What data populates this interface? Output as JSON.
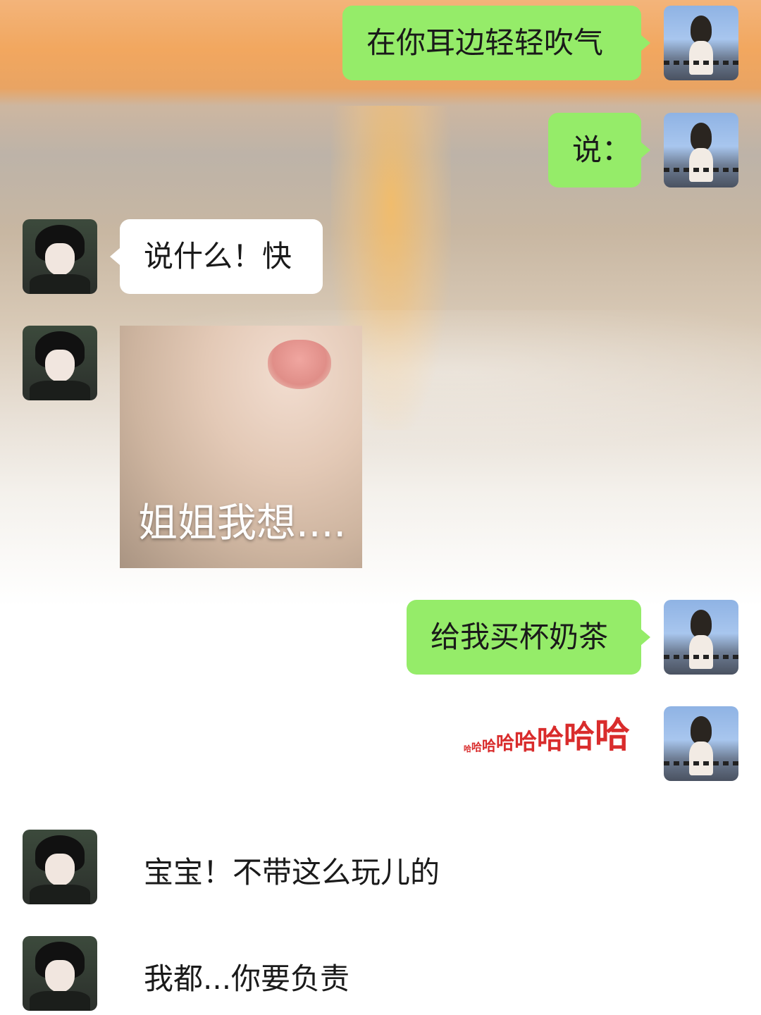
{
  "messages": [
    {
      "side": "right",
      "type": "text",
      "text": "在你耳边轻轻吹气"
    },
    {
      "side": "right",
      "type": "text",
      "text": "说："
    },
    {
      "side": "left",
      "type": "text",
      "text": "说什么！快"
    },
    {
      "side": "left",
      "type": "sticker",
      "caption": "姐姐我想...."
    },
    {
      "side": "right",
      "type": "text",
      "text": "给我买杯奶茶"
    },
    {
      "side": "right",
      "type": "emoji-text",
      "parts": [
        "哈",
        "哈",
        "哈",
        "哈",
        "哈",
        "哈",
        "哈",
        "哈"
      ]
    },
    {
      "side": "left",
      "type": "text",
      "text": "宝宝！不带这么玩儿的"
    },
    {
      "side": "left",
      "type": "text",
      "text": "我都...你要负责"
    }
  ],
  "colors": {
    "self_bubble": "#95ec69",
    "other_bubble": "#ffffff",
    "haha_red": "#d92c2c"
  },
  "avatars": {
    "self": "girl-photo-avatar",
    "other": "anime-boy-avatar"
  }
}
